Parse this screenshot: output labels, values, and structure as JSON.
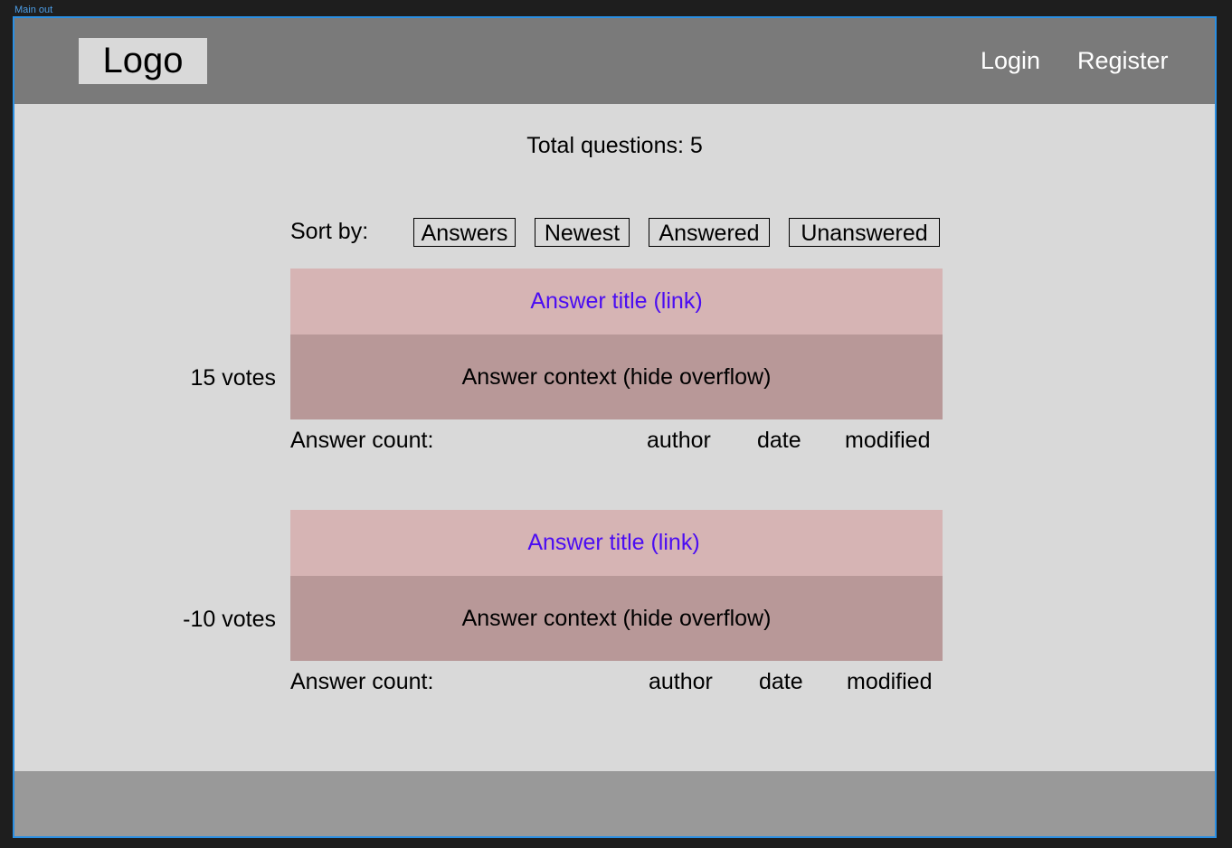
{
  "canvas_label": "Main out",
  "header": {
    "logo": "Logo",
    "nav": {
      "login": "Login",
      "register": "Register"
    }
  },
  "summary": {
    "total_questions": "Total questions: 5"
  },
  "sort": {
    "label": "Sort by:",
    "options": [
      "Answers",
      "Newest",
      "Answered",
      "Unanswered"
    ]
  },
  "questions": [
    {
      "votes": "15 votes",
      "title": "Answer title (link)",
      "context": "Answer context (hide overflow)",
      "answer_count": "Answer count:",
      "author": "author",
      "date": "date",
      "modified": "modified"
    },
    {
      "votes": "-10 votes",
      "title": "Answer title (link)",
      "context": "Answer context (hide overflow)",
      "answer_count": "Answer count:",
      "author": "author",
      "date": "date",
      "modified": "modified"
    }
  ],
  "colors": {
    "header_bg": "#7a7a7a",
    "page_bg": "#d9d9d9",
    "title_bg": "#d6b4b4",
    "context_bg": "#b89898",
    "link": "#4b0df2",
    "footer_bg": "#999999",
    "frame_border": "#2a8fe3"
  }
}
